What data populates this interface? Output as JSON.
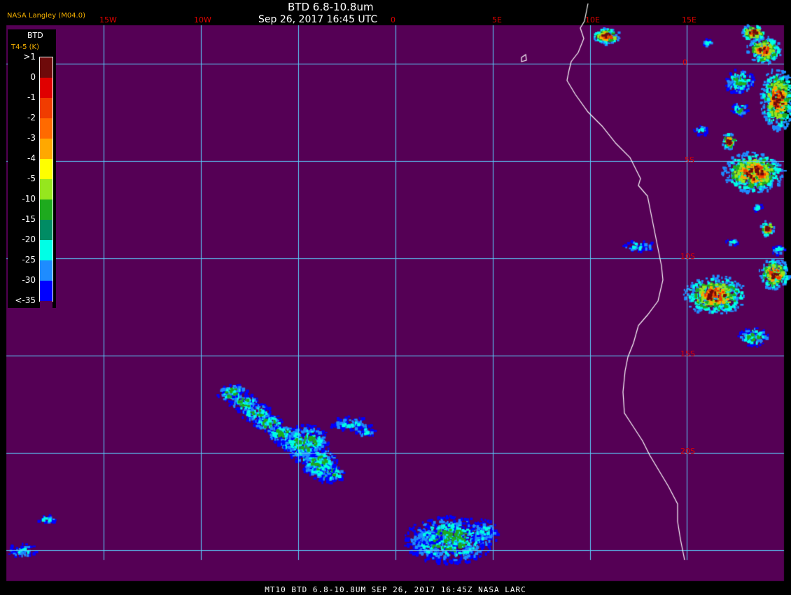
{
  "header": {
    "title": "BTD 6.8-10.8um",
    "datetime": "Sep 26, 2017 16:45 UTC",
    "org": "NASA Langley (M04.0)"
  },
  "footer": "MT10  BTD 6.8-10.8UM  SEP 26, 2017 16:45Z  NASA LARC",
  "legend": {
    "title": "BTD",
    "unit": "T4-5 (K)",
    "ticks": [
      ">1",
      "0",
      "-1",
      "-2",
      "-3",
      "-4",
      "-5",
      "-10",
      "-15",
      "-20",
      "-25",
      "-30",
      "<-35"
    ],
    "colors": [
      "#6e0a0a",
      "#e00000",
      "#f03c00",
      "#ff6a00",
      "#ffa800",
      "#ffff00",
      "#96e61e",
      "#1eaa1e",
      "#008c64",
      "#00ffe6",
      "#1e8cff",
      "#0000ff",
      "#550055"
    ]
  },
  "grid": {
    "lon_labels": [
      "15W",
      "10W",
      "0",
      "5E",
      "10E",
      "15E"
    ],
    "lat_labels": [
      "0",
      "5S",
      "10S",
      "15S",
      "20S"
    ]
  },
  "colors": {
    "background": "#550055",
    "grid": "#5ad2ff",
    "coast": "#ffffff",
    "label_red": "#e00000"
  }
}
